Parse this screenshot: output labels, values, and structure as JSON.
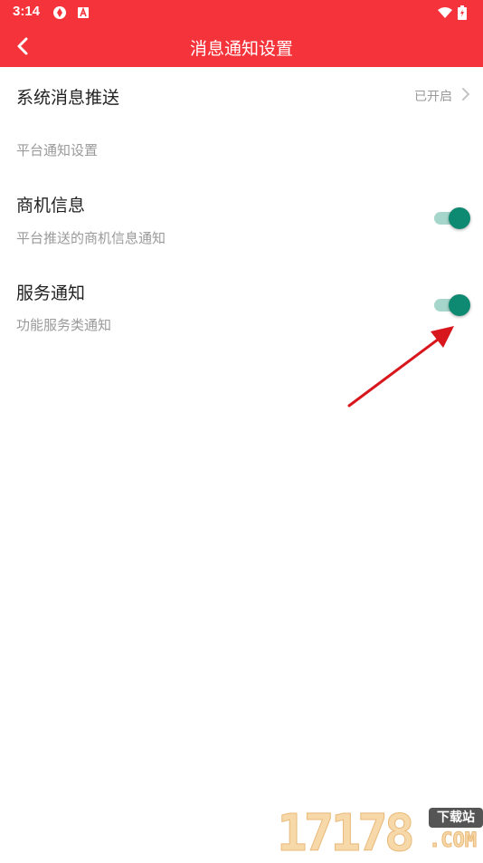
{
  "status_bar": {
    "time": "3:14",
    "icons": [
      "aperture-icon",
      "font-a-icon",
      "wifi-icon",
      "battery-charging-icon"
    ]
  },
  "app_bar": {
    "back_icon": "chevron-left-icon",
    "title": "消息通知设置"
  },
  "system_push": {
    "label": "系统消息推送",
    "value": "已开启"
  },
  "section_header": "平台通知设置",
  "items": [
    {
      "title": "商机信息",
      "subtitle": "平台推送的商机信息通知",
      "enabled": true
    },
    {
      "title": "服务通知",
      "subtitle": "功能服务类通知",
      "enabled": true
    }
  ],
  "watermark": {
    "digits": "17178",
    "badge": "下载站",
    "suffix": ".COM"
  },
  "colors": {
    "brand_red": "#f5333a",
    "toggle_thumb": "#0f8a72",
    "toggle_track": "#a6d6cb",
    "annotation_arrow": "#d8171d"
  }
}
